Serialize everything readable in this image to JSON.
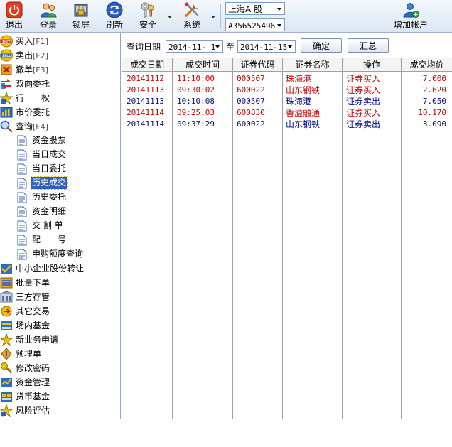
{
  "toolbar": {
    "buttons": [
      {
        "label": "退出",
        "icon": "exit-icon"
      },
      {
        "label": "登录",
        "icon": "login-icon"
      },
      {
        "label": "锁屏",
        "icon": "lock-screen-icon"
      },
      {
        "label": "刷新",
        "icon": "refresh-icon"
      },
      {
        "label": "安全",
        "icon": "security-keys-icon"
      },
      {
        "label": "系统",
        "icon": "system-tools-icon"
      },
      {
        "label": "增加帐户",
        "icon": "add-account-icon"
      }
    ],
    "market_select": "上海A 股",
    "account_select": "A356525496"
  },
  "sidebar": {
    "items": [
      {
        "label": "买入",
        "key": "[F1]",
        "icon": "buy-icon"
      },
      {
        "label": "卖出",
        "key": "[F2]",
        "icon": "sell-icon"
      },
      {
        "label": "撤单",
        "key": "[F3]",
        "icon": "cancel-order-icon"
      },
      {
        "label": "双向委托",
        "key": "",
        "icon": "two-way-order-icon"
      },
      {
        "label": "行　　权",
        "key": "",
        "icon": "exercise-icon"
      },
      {
        "label": "市价委托",
        "key": "",
        "icon": "market-order-icon"
      },
      {
        "label": "查询",
        "key": "[F4]",
        "icon": "query-icon"
      }
    ],
    "query_sub": [
      {
        "label": "资金股票"
      },
      {
        "label": "当日成交"
      },
      {
        "label": "当日委托"
      },
      {
        "label": "历史成交"
      },
      {
        "label": "历史委托"
      },
      {
        "label": "资金明细"
      },
      {
        "label": "交 割 单"
      },
      {
        "label": "配　　号"
      },
      {
        "label": "申购额度查询"
      }
    ],
    "more_items": [
      {
        "label": "中小企业股份转让",
        "icon": "sme-transfer-icon"
      },
      {
        "label": "批量下单",
        "icon": "batch-order-icon"
      },
      {
        "label": "三方存管",
        "icon": "third-party-custody-icon"
      },
      {
        "label": "其它交易",
        "icon": "other-trade-icon"
      },
      {
        "label": "场内基金",
        "icon": "exchange-fund-icon"
      },
      {
        "label": "新业务申请",
        "icon": "new-business-icon"
      },
      {
        "label": "预埋单",
        "icon": "preset-order-icon"
      },
      {
        "label": "修改密码",
        "icon": "password-key-icon"
      },
      {
        "label": "资金管理",
        "icon": "fund-management-icon"
      },
      {
        "label": "货币基金",
        "icon": "money-fund-icon"
      },
      {
        "label": "风险评估",
        "icon": "risk-assessment-icon"
      }
    ]
  },
  "filter": {
    "label": "查询日期",
    "start_date": "2014-11- 1",
    "to_label": "至",
    "end_date": "2014-11-15",
    "confirm_label": "确定",
    "summary_label": "汇总"
  },
  "table": {
    "columns": [
      "成交日期",
      "成交时间",
      "证券代码",
      "证券名称",
      "操作",
      "成交均价"
    ],
    "rows": [
      {
        "date": "20141112",
        "time": "11:10:00",
        "code": "000507",
        "name": "珠海港",
        "op": "证券买入",
        "price": "7.000",
        "kind": "buy"
      },
      {
        "date": "20141113",
        "time": "09:30:02",
        "code": "600022",
        "name": "山东钢铁",
        "op": "证券买入",
        "price": "2.620",
        "kind": "buy"
      },
      {
        "date": "20141113",
        "time": "10:10:08",
        "code": "000507",
        "name": "珠海港",
        "op": "证券卖出",
        "price": "7.050",
        "kind": "sell"
      },
      {
        "date": "20141114",
        "time": "09:25:03",
        "code": "600830",
        "name": "香溢融通",
        "op": "证券买入",
        "price": "10.170",
        "kind": "buy"
      },
      {
        "date": "20141114",
        "time": "09:37:29",
        "code": "600022",
        "name": "山东钢铁",
        "op": "证券卖出",
        "price": "3.090",
        "kind": "sell"
      }
    ]
  }
}
